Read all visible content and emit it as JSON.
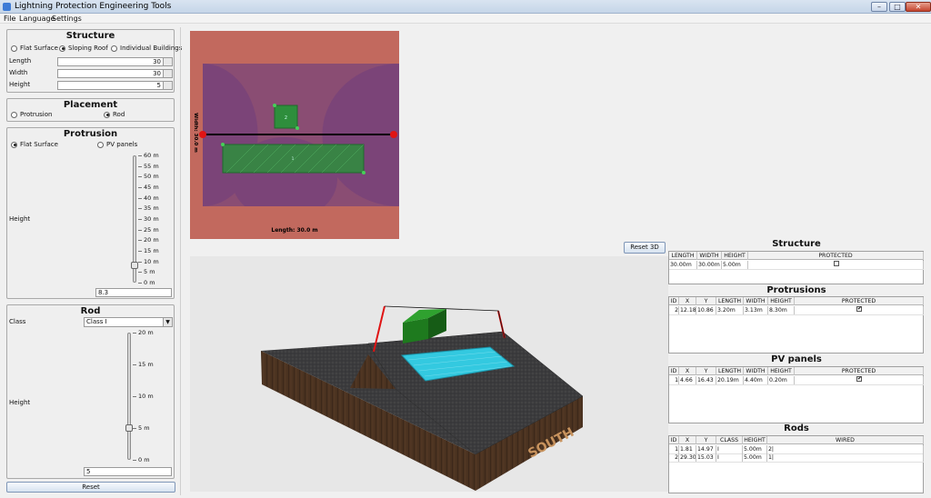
{
  "window": {
    "title": "Lightning Protection Engineering Tools"
  },
  "menu": [
    "File",
    "Language",
    "Settings"
  ],
  "structure_panel": {
    "title": "Structure",
    "options": [
      {
        "label": "Flat Surface",
        "selected": false
      },
      {
        "label": "Sloping Roof",
        "selected": true
      },
      {
        "label": "Individual Buildings",
        "selected": false
      }
    ],
    "fields": [
      {
        "label": "Length",
        "value": "30"
      },
      {
        "label": "Width",
        "value": "30"
      },
      {
        "label": "Height",
        "value": "5"
      }
    ]
  },
  "placement_panel": {
    "title": "Placement",
    "options": [
      {
        "label": "Protrusion",
        "selected": false
      },
      {
        "label": "Rod",
        "selected": true
      }
    ]
  },
  "protrusion_panel": {
    "title": "Protrusion",
    "options": [
      {
        "label": "Flat Surface",
        "selected": true
      },
      {
        "label": "PV panels",
        "selected": false
      }
    ],
    "height_label": "Height",
    "ticks": [
      "60 m",
      "55 m",
      "50 m",
      "45 m",
      "40 m",
      "35 m",
      "30 m",
      "25 m",
      "20 m",
      "15 m",
      "10 m",
      "5 m",
      "0 m"
    ],
    "slider_value": 8.3,
    "value_text": "8.3"
  },
  "rod_panel": {
    "title": "Rod",
    "class_label": "Class",
    "class_value": "Class I",
    "height_label": "Height",
    "ticks": [
      "20 m",
      "15 m",
      "10 m",
      "5 m",
      "0 m"
    ],
    "slider_value": 5,
    "value_text": "5"
  },
  "reset_label": "Reset",
  "reset3d_label": "Reset 3D",
  "view2d": {
    "width_label": "Width: 30.0 m",
    "length_label": "Length: 30.0 m",
    "protrusion_label": "2",
    "panel_label": "1"
  },
  "view3d": {
    "label_text": "SOUTH"
  },
  "tables": {
    "structure": {
      "title": "Structure",
      "headers": [
        "LENGTH",
        "WIDTH",
        "HEIGHT",
        "PROTECTED"
      ],
      "rows": [
        {
          "cells": [
            "30.00m",
            "30.00m",
            "5.00m"
          ],
          "protected": false
        }
      ]
    },
    "protrusions": {
      "title": "Protrusions",
      "headers": [
        "ID",
        "X",
        "Y",
        "LENGTH",
        "WIDTH",
        "HEIGHT",
        "PROTECTED"
      ],
      "rows": [
        {
          "cells": [
            "2",
            "12.18",
            "10.86",
            "3.20m",
            "3.13m",
            "8.30m"
          ],
          "protected": true
        }
      ]
    },
    "pv_panels": {
      "title": "PV panels",
      "headers": [
        "ID",
        "X",
        "Y",
        "LENGTH",
        "WIDTH",
        "HEIGHT",
        "PROTECTED"
      ],
      "rows": [
        {
          "cells": [
            "1",
            "4.66",
            "16.43",
            "20.19m",
            "4.40m",
            "0.20m"
          ],
          "protected": true
        }
      ]
    },
    "rods": {
      "title": "Rods",
      "headers": [
        "ID",
        "X",
        "Y",
        "CLASS",
        "HEIGHT",
        "WIRED"
      ],
      "rows": [
        {
          "cells": [
            "1",
            "1.81",
            "14.97",
            "I",
            "5.00m",
            "2|"
          ]
        },
        {
          "cells": [
            "2",
            "29.30",
            "15.03",
            "I",
            "5.00m",
            "1|"
          ]
        }
      ]
    }
  },
  "colors": {
    "roof_outer": "#c2695e",
    "roof_inner": "#8a4d73",
    "zone_purple": "#7b4478",
    "selection_green": "#2e8e3c",
    "rod_red": "#e01414",
    "pv_cyan": "#33c9e0"
  }
}
